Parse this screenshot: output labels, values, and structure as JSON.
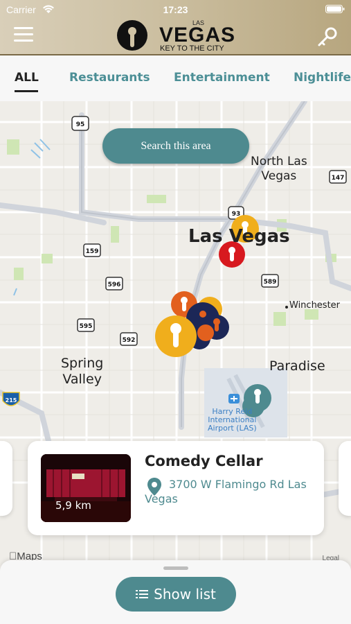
{
  "status_bar": {
    "carrier": "Carrier",
    "time": "17:23"
  },
  "header": {
    "logo_small": "LAS",
    "logo_main": "VEGAS",
    "logo_tagline": "KEY TO THE CITY",
    "icons": [
      "menu-icon",
      "key-icon",
      "wifi-icon",
      "battery-icon"
    ]
  },
  "tabs": [
    {
      "label": "ALL",
      "active": true
    },
    {
      "label": "Restaurants",
      "active": false
    },
    {
      "label": "Entertainment",
      "active": false
    },
    {
      "label": "Nightlife",
      "active": false
    }
  ],
  "map": {
    "search_button": "Search this area",
    "labels": {
      "north_las_vegas": "North Las\nVegas",
      "las_vegas": "Las Vegas",
      "winchester": "Winchester",
      "spring_valley": "Spring\nValley",
      "paradise": "Paradise",
      "airport": "Harry Reid\nInternational\nAirport (LAS)"
    },
    "route_shields": [
      "95",
      "93",
      "147",
      "159",
      "596",
      "589",
      "595",
      "592",
      "215"
    ],
    "attribution": "Maps",
    "legal": "Legal",
    "pin_colors": {
      "red": "#d7191f",
      "orange": "#e2601e",
      "yellow": "#f0ae1c",
      "navy": "#1c2757",
      "teal": "#4e8a8f"
    }
  },
  "card": {
    "title": "Comedy Cellar",
    "address": "3700 W Flamingo Rd Las Vegas",
    "distance": "5,9 km"
  },
  "bottom": {
    "show_list": "Show list"
  }
}
